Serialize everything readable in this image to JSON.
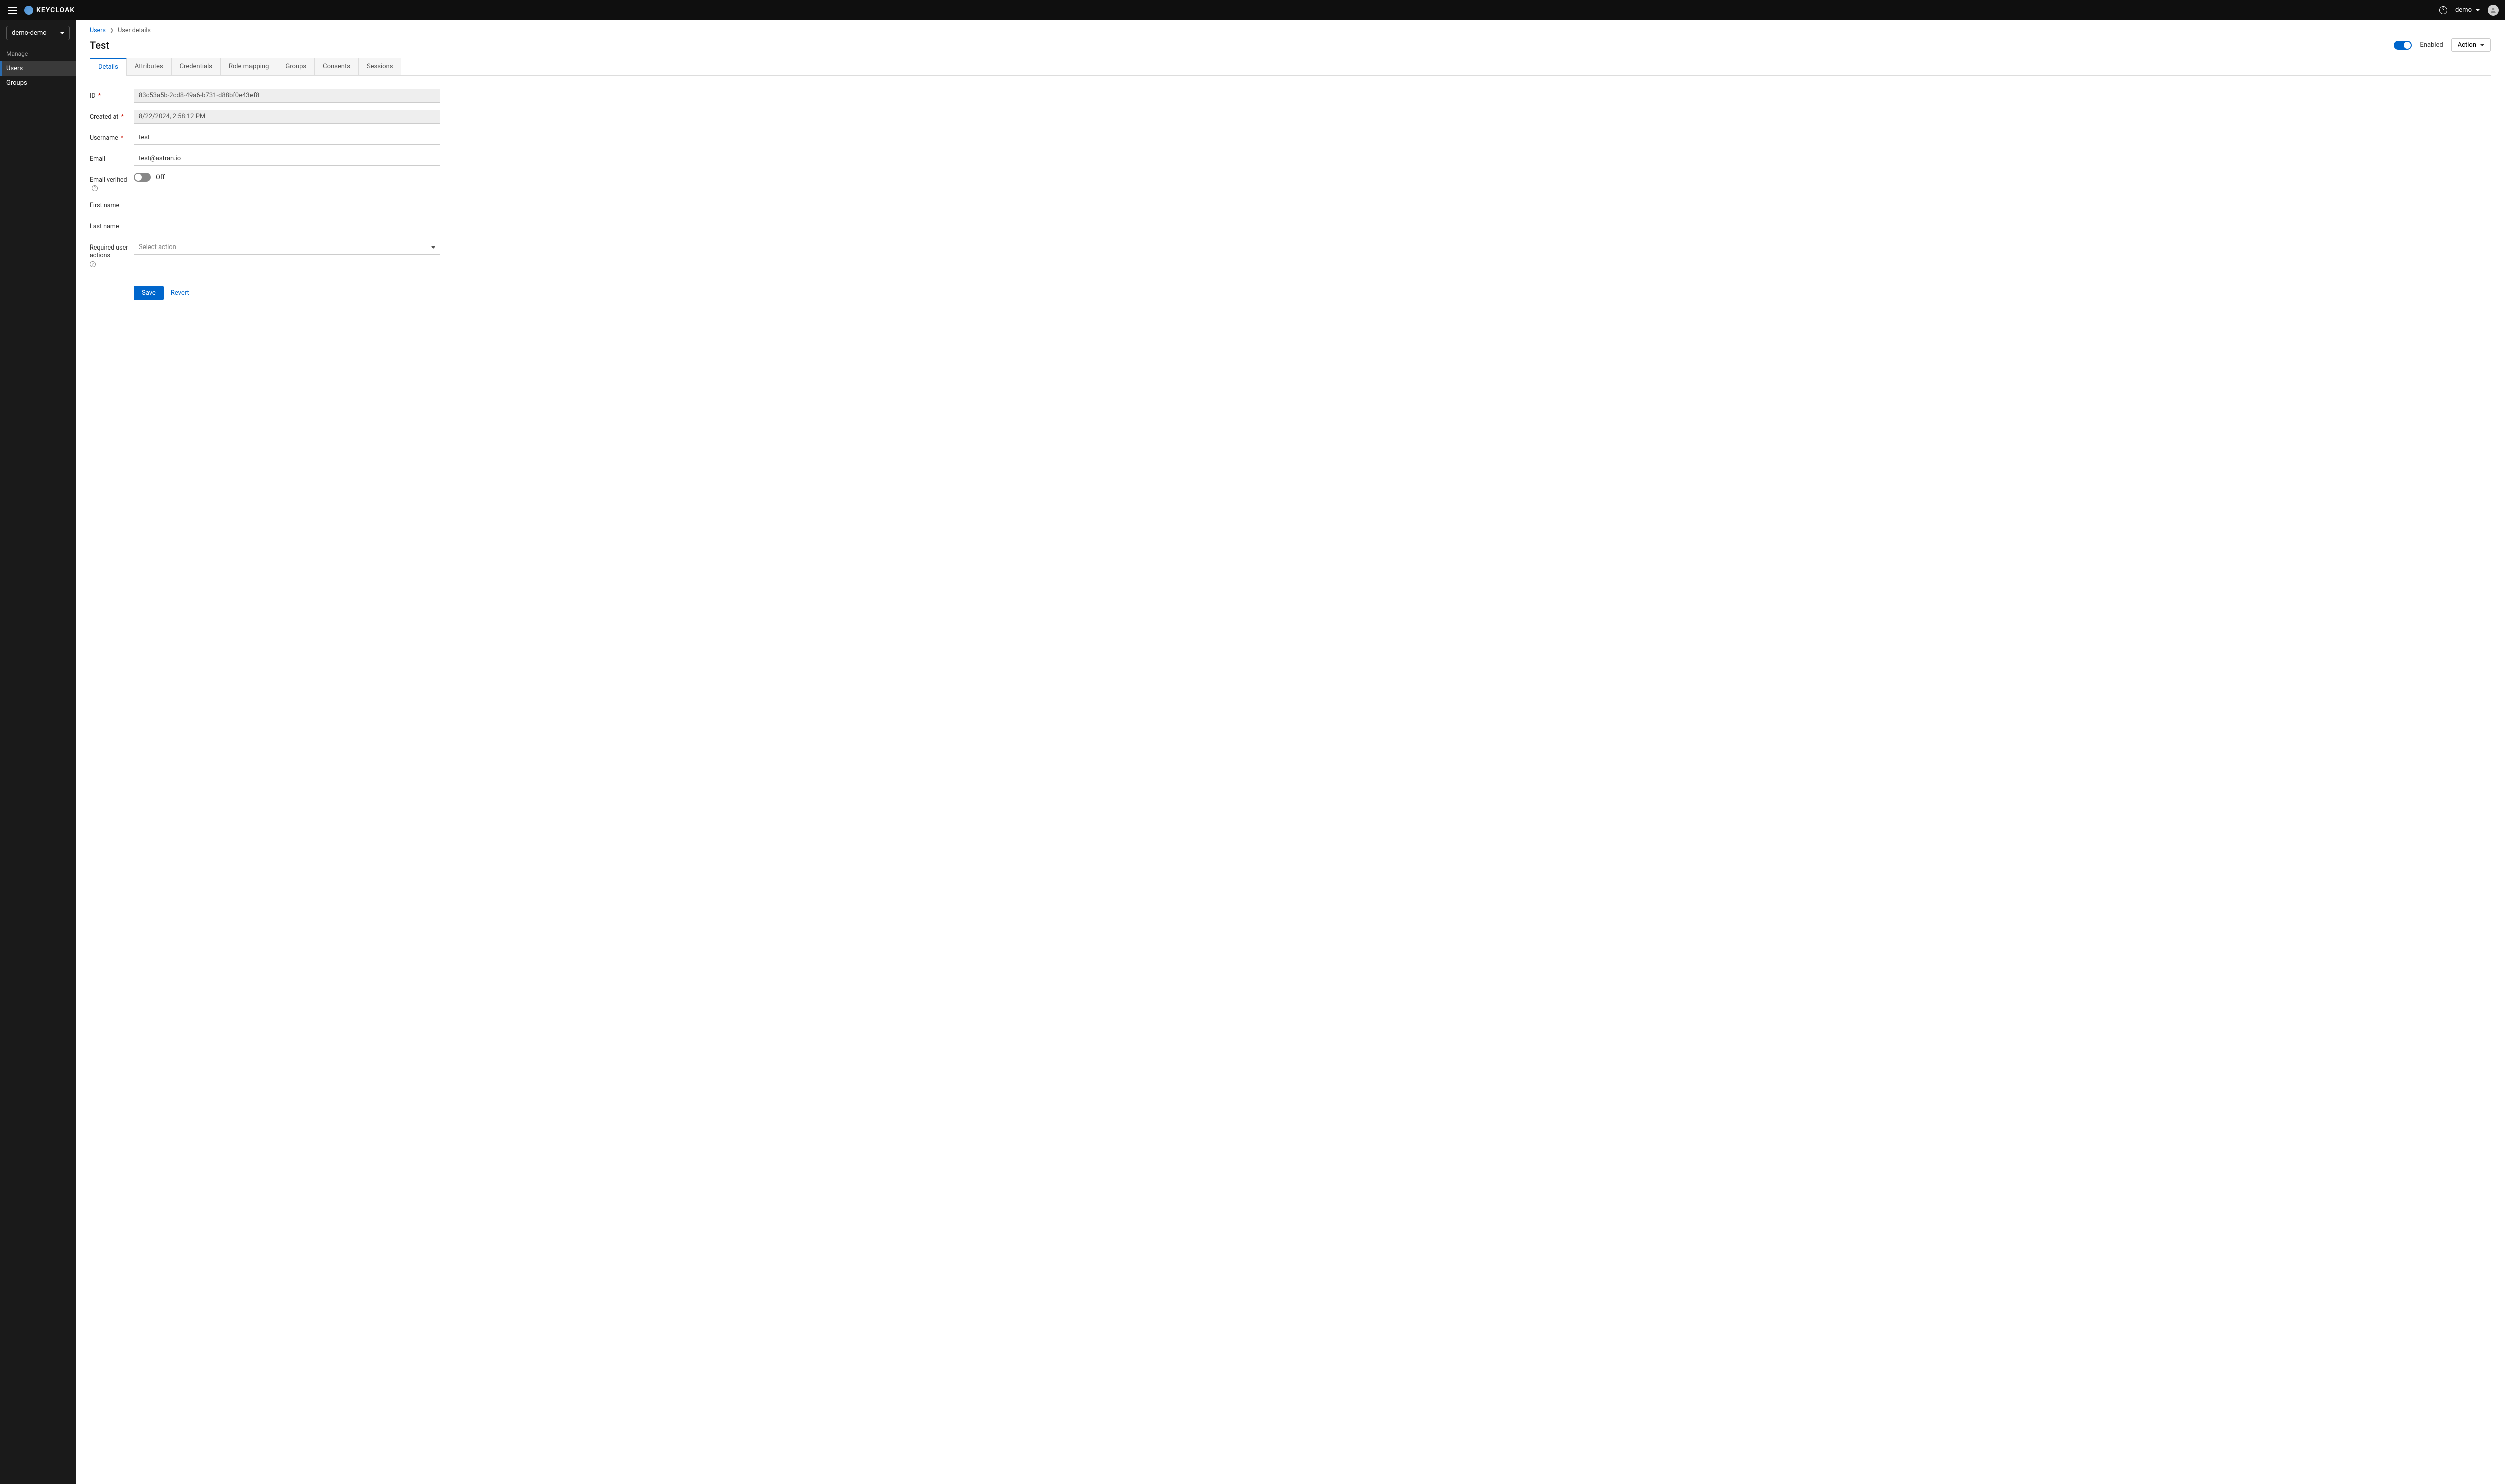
{
  "header": {
    "logo_text": "KEYCLOAK",
    "username": "demo"
  },
  "sidebar": {
    "realm": "demo-demo",
    "section_label": "Manage",
    "items": [
      {
        "label": "Users",
        "active": true
      },
      {
        "label": "Groups",
        "active": false
      }
    ]
  },
  "breadcrumb": {
    "root": "Users",
    "current": "User details"
  },
  "page": {
    "title": "Test",
    "enabled_label": "Enabled",
    "action_label": "Action"
  },
  "tabs": [
    {
      "label": "Details",
      "active": true
    },
    {
      "label": "Attributes",
      "active": false
    },
    {
      "label": "Credentials",
      "active": false
    },
    {
      "label": "Role mapping",
      "active": false
    },
    {
      "label": "Groups",
      "active": false
    },
    {
      "label": "Consents",
      "active": false
    },
    {
      "label": "Sessions",
      "active": false
    }
  ],
  "form": {
    "id_label": "ID",
    "id_value": "83c53a5b-2cd8-49a6-b731-d88bf0e43ef8",
    "created_at_label": "Created at",
    "created_at_value": "8/22/2024, 2:58:12 PM",
    "username_label": "Username",
    "username_value": "test",
    "email_label": "Email",
    "email_value": "test@astran.io",
    "email_verified_label": "Email verified",
    "email_verified_value": "Off",
    "first_name_label": "First name",
    "first_name_value": "",
    "last_name_label": "Last name",
    "last_name_value": "",
    "required_actions_label": "Required user actions",
    "required_actions_placeholder": "Select action",
    "save_label": "Save",
    "revert_label": "Revert"
  }
}
